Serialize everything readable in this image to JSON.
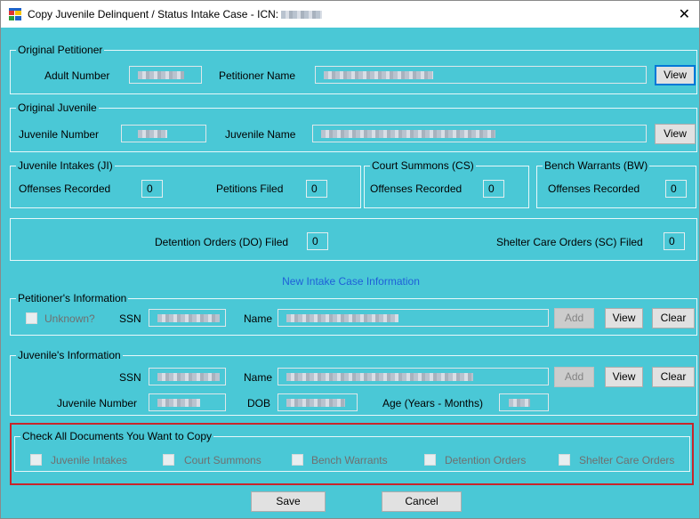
{
  "window": {
    "title": "Copy Juvenile Delinquent / Status Intake Case - ICN:",
    "close_label": "✕"
  },
  "original_petitioner": {
    "legend": "Original Petitioner",
    "adult_number_label": "Adult Number",
    "petitioner_name_label": "Petitioner Name",
    "view_label": "View"
  },
  "original_juvenile": {
    "legend": "Original Juvenile",
    "juvenile_number_label": "Juvenile Number",
    "juvenile_name_label": "Juvenile Name",
    "view_label": "View"
  },
  "juvenile_intakes": {
    "legend": "Juvenile Intakes (JI)",
    "offenses_label": "Offenses Recorded",
    "offenses_value": "0",
    "petitions_label": "Petitions Filed",
    "petitions_value": "0"
  },
  "court_summons": {
    "legend": "Court Summons (CS)",
    "offenses_label": "Offenses Recorded",
    "offenses_value": "0"
  },
  "bench_warrants": {
    "legend": "Bench Warrants (BW)",
    "offenses_label": "Offenses Recorded",
    "offenses_value": "0"
  },
  "orders": {
    "detention_label": "Detention Orders (DO) Filed",
    "detention_value": "0",
    "shelter_label": "Shelter Care Orders (SC) Filed",
    "shelter_value": "0"
  },
  "new_intake_heading": "New Intake Case Information",
  "petitioner_info": {
    "legend": "Petitioner's Information",
    "unknown_label": "Unknown?",
    "ssn_label": "SSN",
    "name_label": "Name",
    "add_label": "Add",
    "view_label": "View",
    "clear_label": "Clear"
  },
  "juvenile_info": {
    "legend": "Juvenile's Information",
    "ssn_label": "SSN",
    "name_label": "Name",
    "juvenile_number_label": "Juvenile Number",
    "dob_label": "DOB",
    "age_label": "Age (Years - Months)",
    "add_label": "Add",
    "view_label": "View",
    "clear_label": "Clear"
  },
  "copy_documents": {
    "legend": "Check All Documents You Want to Copy",
    "items": [
      "Juvenile Intakes",
      "Court Summons",
      "Bench Warrants",
      "Detention Orders",
      "Shelter Care Orders"
    ]
  },
  "footer": {
    "save_label": "Save",
    "cancel_label": "Cancel"
  },
  "colors": {
    "background": "#4ac8d6",
    "highlight_border": "#c8252a",
    "section_heading": "#1f5fd8"
  }
}
